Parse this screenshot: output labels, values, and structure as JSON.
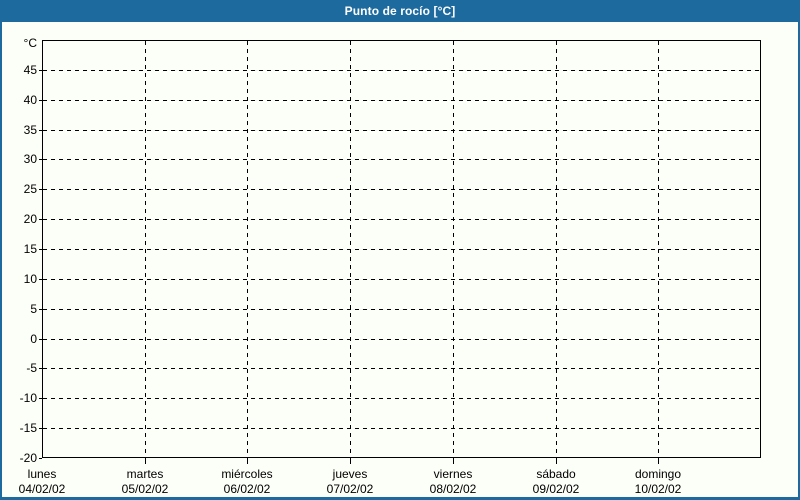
{
  "window": {
    "title": "Punto de rocío [°C]"
  },
  "colors": {
    "accent_blue": "#1d6b9e",
    "title_text": "#ffffff",
    "page_background": "#fcfef8",
    "grid_and_axis": "#000000",
    "label_text": "#000000"
  },
  "chart_data": {
    "type": "line",
    "title": "Punto de rocío [°C]",
    "ylabel": "°C",
    "ylim": [
      -20,
      50
    ],
    "y_ticks": [
      45,
      40,
      35,
      30,
      25,
      20,
      15,
      10,
      5,
      0,
      -5,
      -10,
      -15,
      -20
    ],
    "x_categories": [
      {
        "day": "lunes",
        "date": "04/02/02"
      },
      {
        "day": "martes",
        "date": "05/02/02"
      },
      {
        "day": "miércoles",
        "date": "06/02/02"
      },
      {
        "day": "jueves",
        "date": "07/02/02"
      },
      {
        "day": "viernes",
        "date": "08/02/02"
      },
      {
        "day": "sábado",
        "date": "09/02/02"
      },
      {
        "day": "domingo",
        "date": "10/02/02"
      }
    ],
    "grid": "dashed",
    "legend_position": "none",
    "series": []
  }
}
